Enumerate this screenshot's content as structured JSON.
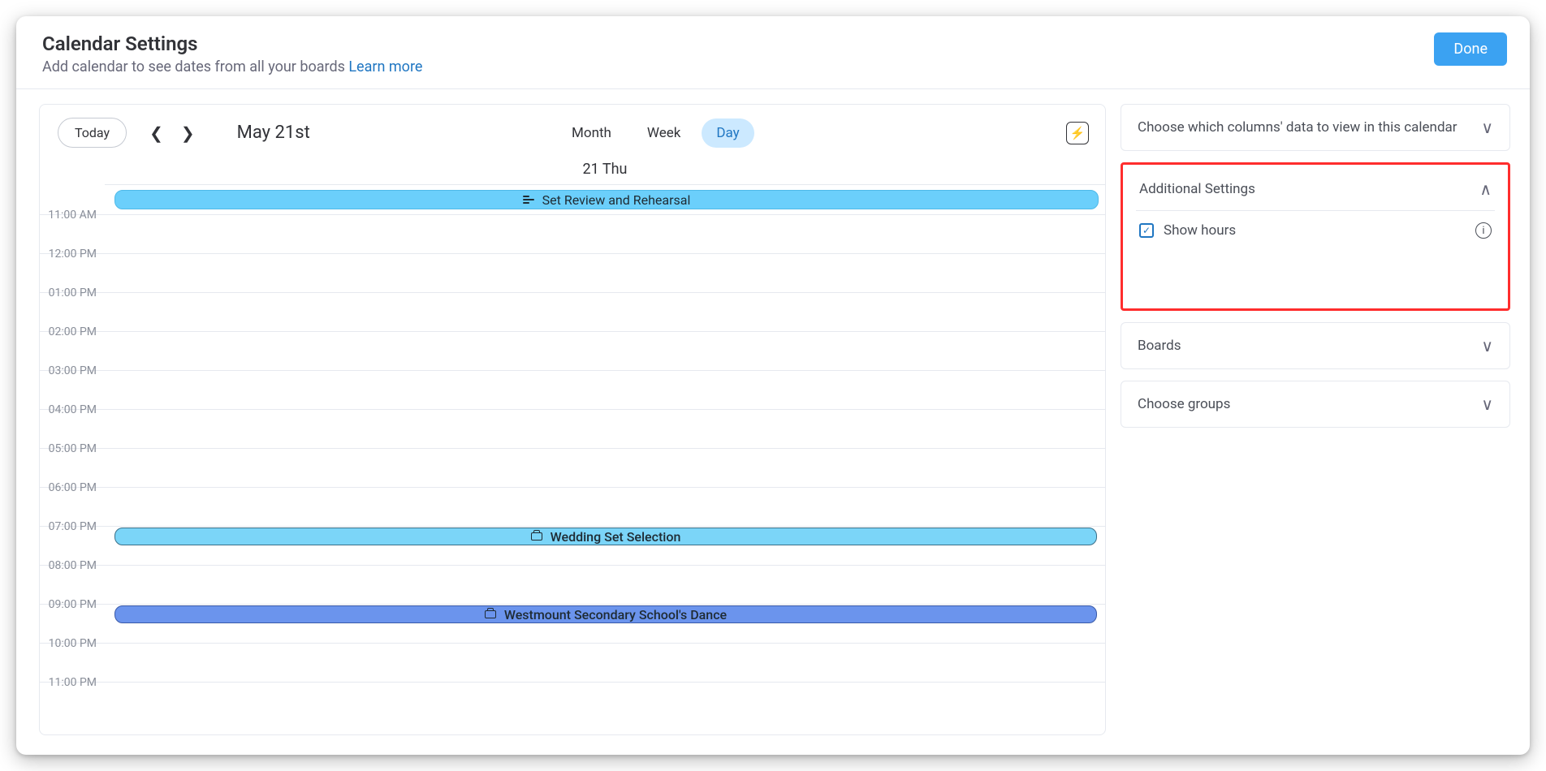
{
  "header": {
    "title": "Calendar Settings",
    "subtitle": "Add calendar to see dates from all your boards ",
    "learn_more": "Learn more",
    "done": "Done"
  },
  "calendar": {
    "today": "Today",
    "current_date": "May 21st",
    "views": {
      "month": "Month",
      "week": "Week",
      "day": "Day"
    },
    "active_view": "day",
    "day_header": "21 Thu",
    "allday_event": {
      "title": "Set Review and Rehearsal"
    },
    "hours": [
      "11:00 AM",
      "12:00 PM",
      "01:00 PM",
      "02:00 PM",
      "03:00 PM",
      "04:00 PM",
      "05:00 PM",
      "06:00 PM",
      "07:00 PM",
      "08:00 PM",
      "09:00 PM",
      "10:00 PM",
      "11:00 PM"
    ],
    "events": [
      {
        "title": "Wedding Set Selection",
        "row_index": 8,
        "color": "light"
      },
      {
        "title": "Westmount Secondary School's Dance",
        "row_index": 10,
        "color": "dark"
      }
    ]
  },
  "sidebar": {
    "columns": "Choose which columns' data to view in this calendar",
    "additional": {
      "title": "Additional Settings",
      "show_hours": "Show hours"
    },
    "boards": "Boards",
    "groups": "Choose groups"
  }
}
